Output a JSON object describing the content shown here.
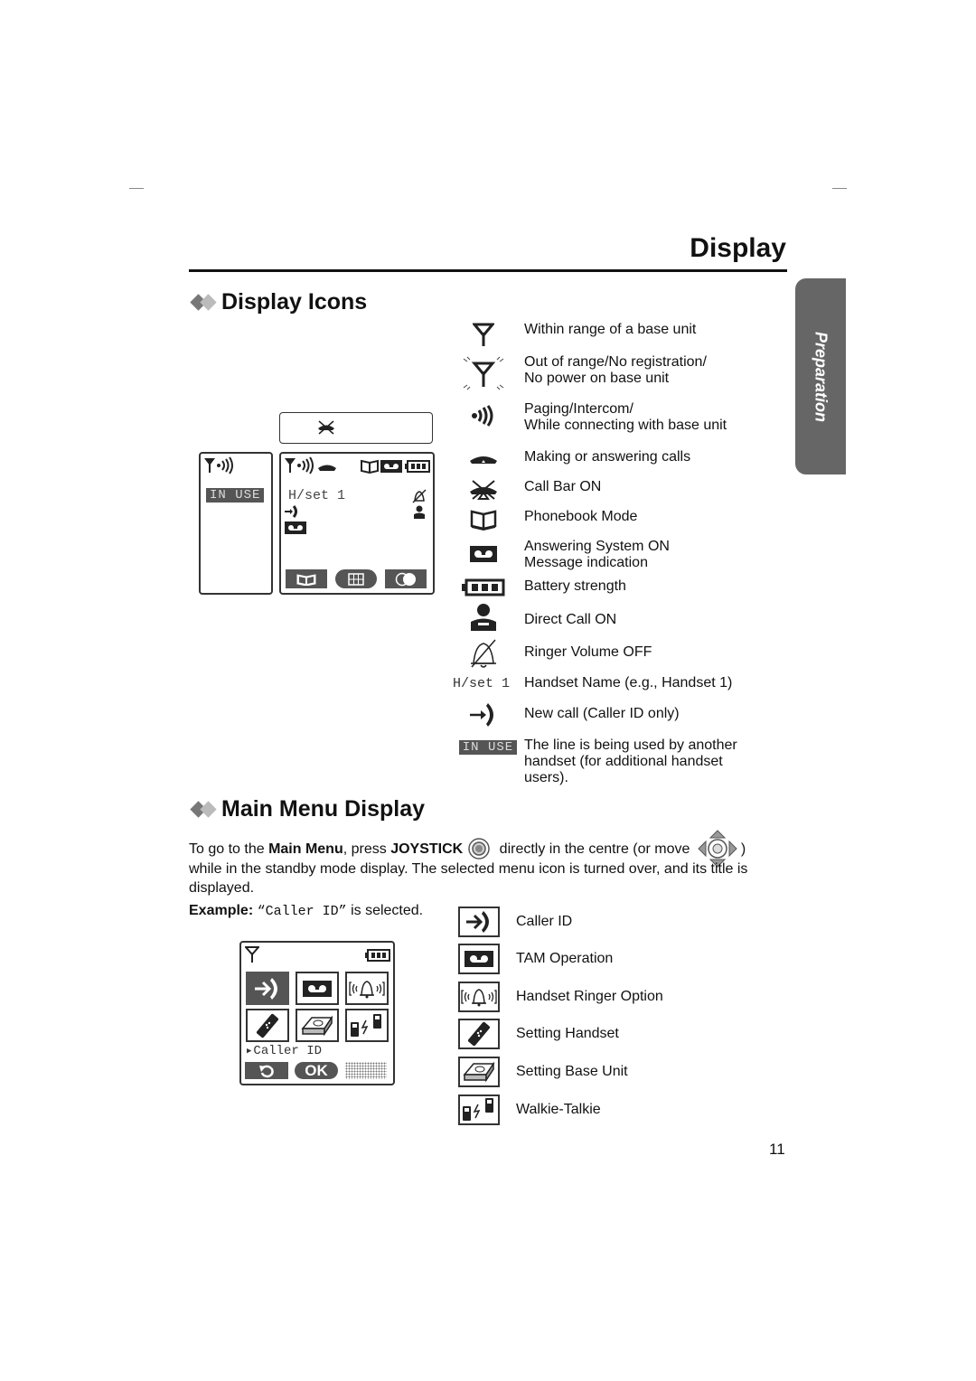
{
  "header": {
    "title": "Display"
  },
  "side_tab": {
    "label": "Preparation"
  },
  "section1": {
    "heading": "Display Icons",
    "lcd_left": {
      "status": "IN USE"
    },
    "lcd_right": {
      "handset_name": "H/set 1"
    },
    "icons": [
      {
        "icon": "antenna-icon",
        "text": "Within range of a base unit"
      },
      {
        "icon": "antenna-flashing-icon",
        "text": "Out of range/No registration/\nNo power on base unit"
      },
      {
        "icon": "signal-waves-icon",
        "text": "Paging/Intercom/\nWhile connecting with base unit"
      },
      {
        "icon": "handset-icon",
        "text": "Making or answering calls"
      },
      {
        "icon": "call-bar-icon",
        "text": "Call Bar ON"
      },
      {
        "icon": "phonebook-icon",
        "text": "Phonebook Mode"
      },
      {
        "icon": "tape-icon",
        "text": "Answering System ON\nMessage indication"
      },
      {
        "icon": "battery-icon",
        "text": "Battery strength"
      },
      {
        "icon": "person-icon",
        "text": "Direct Call ON"
      },
      {
        "icon": "bell-off-icon",
        "text": "Ringer Volume OFF"
      },
      {
        "icon_text": "H/set 1",
        "text": "Handset Name (e.g., Handset 1)"
      },
      {
        "icon": "new-call-icon",
        "text": "New call (Caller ID only)"
      },
      {
        "icon_text": "IN USE",
        "text": "The line is being used by another\nhandset (for additional handset\nusers)."
      }
    ]
  },
  "section2": {
    "heading": "Main Menu Display",
    "p1_a": "To go to the ",
    "p1_b": "Main Menu",
    "p1_c": ", press ",
    "p1_d": "JOYSTICK",
    "p1_e": " directly in the centre (or move ",
    "p1_f": ")",
    "p2": "while in the standby mode display. The selected menu icon is turned over, and its title is displayed.",
    "example_label": "Example:",
    "example_value": "“Caller ID”",
    "example_suffix": " is selected.",
    "lcd": {
      "selected_title": "Caller ID",
      "ok": "OK"
    },
    "menu": [
      {
        "icon": "caller-id-icon",
        "label": "Caller ID"
      },
      {
        "icon": "tam-icon",
        "label": "TAM Operation"
      },
      {
        "icon": "ringer-icon",
        "label": "Handset Ringer Option"
      },
      {
        "icon": "handset-setting-icon",
        "label": "Setting Handset"
      },
      {
        "icon": "base-unit-icon",
        "label": "Setting Base Unit"
      },
      {
        "icon": "walkie-talkie-icon",
        "label": "Walkie-Talkie"
      }
    ]
  },
  "footer": {
    "page_number": "11"
  }
}
